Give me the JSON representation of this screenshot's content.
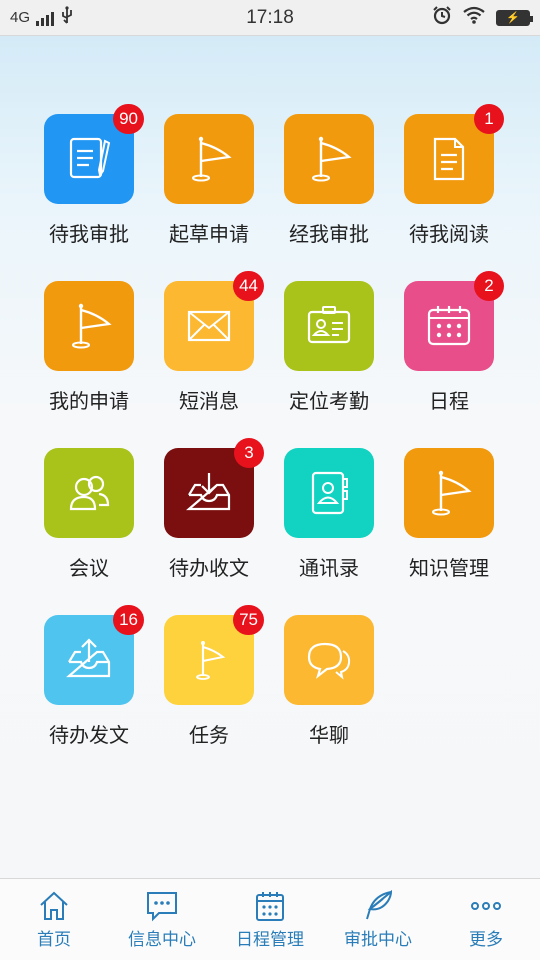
{
  "status_bar": {
    "network": "4G",
    "time": "17:18"
  },
  "apps": [
    {
      "label": "待我审批",
      "badge": "90",
      "color": "#2196f3",
      "icon": "document-pen-icon"
    },
    {
      "label": "起草申请",
      "badge": "",
      "color": "#f29a0e",
      "icon": "flag-icon"
    },
    {
      "label": "经我审批",
      "badge": "",
      "color": "#f29a0e",
      "icon": "flag-icon"
    },
    {
      "label": "待我阅读",
      "badge": "1",
      "color": "#f29a0e",
      "icon": "document-icon"
    },
    {
      "label": "我的申请",
      "badge": "",
      "color": "#f29a0e",
      "icon": "flag-icon"
    },
    {
      "label": "短消息",
      "badge": "44",
      "color": "#fbb830",
      "icon": "envelope-icon"
    },
    {
      "label": "定位考勤",
      "badge": "",
      "color": "#a9c31a",
      "icon": "id-card-icon"
    },
    {
      "label": "日程",
      "badge": "2",
      "color": "#e84e8a",
      "icon": "calendar-icon"
    },
    {
      "label": "会议",
      "badge": "",
      "color": "#a9c31a",
      "icon": "people-icon"
    },
    {
      "label": "待办收文",
      "badge": "3",
      "color": "#7b0f0f",
      "icon": "inbox-download-icon"
    },
    {
      "label": "通讯录",
      "badge": "",
      "color": "#12d3c1",
      "icon": "contacts-book-icon"
    },
    {
      "label": "知识管理",
      "badge": "",
      "color": "#f29a0e",
      "icon": "flag-icon"
    },
    {
      "label": "待办发文",
      "badge": "16",
      "color": "#4ec4ee",
      "icon": "inbox-upload-icon"
    },
    {
      "label": "任务",
      "badge": "75",
      "color": "#fdd23c",
      "icon": "flag-icon"
    },
    {
      "label": "华聊",
      "badge": "",
      "color": "#fbb830",
      "icon": "chat-bubbles-icon"
    }
  ],
  "bottom_nav": [
    {
      "label": "首页",
      "icon": "home-icon"
    },
    {
      "label": "信息中心",
      "icon": "message-icon"
    },
    {
      "label": "日程管理",
      "icon": "calendar-icon"
    },
    {
      "label": "审批中心",
      "icon": "feather-icon"
    },
    {
      "label": "更多",
      "icon": "more-icon"
    }
  ],
  "colors": {
    "accent": "#2a7db8",
    "badge": "#e8121d"
  }
}
